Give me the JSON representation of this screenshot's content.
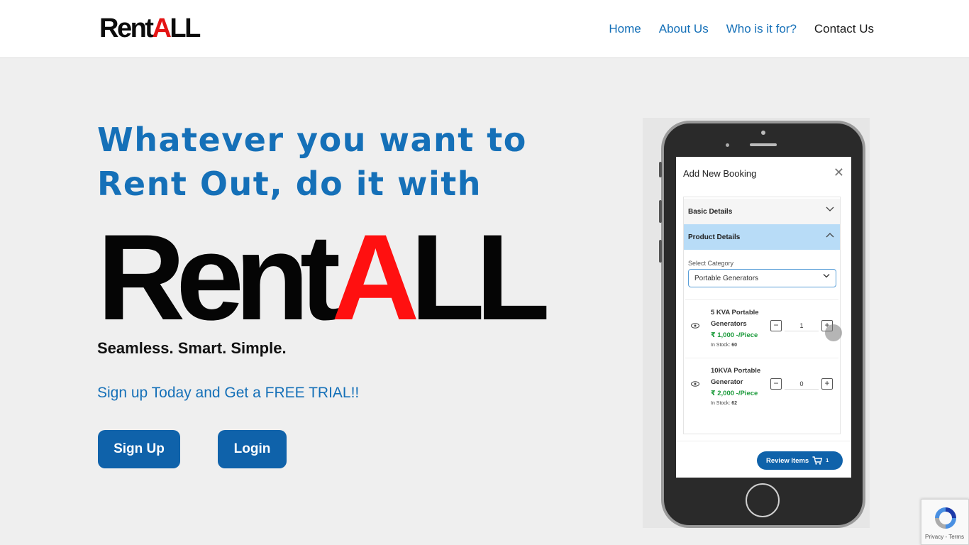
{
  "header": {
    "logo": {
      "prefix": "Rent",
      "accent": "A",
      "suffix": "LL"
    },
    "nav": [
      {
        "label": "Home"
      },
      {
        "label": "About Us"
      },
      {
        "label": "Who is it for?"
      },
      {
        "label": "Contact Us"
      }
    ]
  },
  "hero": {
    "title": "Whatever you want to Rent Out, do it with",
    "logo": {
      "prefix": "Rent",
      "accent": "A",
      "suffix": "LL"
    },
    "tagline": "Seamless. Smart. Simple.",
    "trial": "Sign up Today and Get a FREE TRIAL!!",
    "signup_label": "Sign Up",
    "login_label": "Login"
  },
  "phone": {
    "screen_title": "Add New Booking",
    "close": "✕",
    "basic_details": "Basic Details",
    "product_details": "Product Details",
    "category_label": "Select Category",
    "category_value": "Portable Generators",
    "products": [
      {
        "name": "5 KVA Portable Generators",
        "price": "₹ 1,000 -/Piece",
        "stock_label": "In Stock:",
        "stock": "60",
        "qty": "1"
      },
      {
        "name": "10KVA Portable Generator",
        "price": "₹ 2,000 -/Piece",
        "stock_label": "In Stock:",
        "stock": "62",
        "qty": "0"
      }
    ],
    "review_label": "Review Items",
    "review_count": "1"
  },
  "recaptcha": {
    "text": "Privacy - Terms"
  },
  "colors": {
    "brand_blue": "#1570b8",
    "button_blue": "#0f62aa",
    "logo_red": "#e41414",
    "price_green": "#1a9a3a"
  }
}
